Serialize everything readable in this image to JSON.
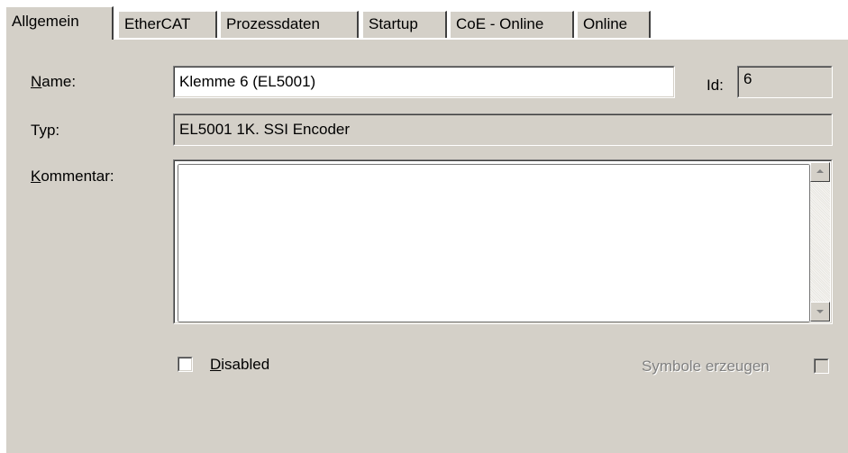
{
  "tabs": [
    {
      "label": "Allgemein",
      "active": true
    },
    {
      "label": "EtherCAT",
      "active": false
    },
    {
      "label": "Prozessdaten",
      "active": false
    },
    {
      "label": "Startup",
      "active": false
    },
    {
      "label": "CoE - Online",
      "active": false
    },
    {
      "label": "Online",
      "active": false
    }
  ],
  "general": {
    "name_label_accel": "N",
    "name_label_rest": "ame:",
    "name_value": "Klemme 6 (EL5001)",
    "id_label": "Id:",
    "id_value": "6",
    "type_label": "Typ:",
    "type_value": "EL5001 1K. SSI Encoder",
    "comment_label_accel": "K",
    "comment_label_rest": "ommentar:",
    "comment_value": "",
    "disabled_label_accel": "D",
    "disabled_label_rest": "isabled",
    "disabled_checked": false,
    "symbols_label": "Symbole erzeugen",
    "symbols_checked": false,
    "symbols_enabled": false
  },
  "colors": {
    "face": "#d4d0c8",
    "window": "#ffffff",
    "disabled_text": "#808080"
  },
  "icons": [
    "scroll-up-arrow-icon",
    "scroll-down-arrow-icon"
  ]
}
